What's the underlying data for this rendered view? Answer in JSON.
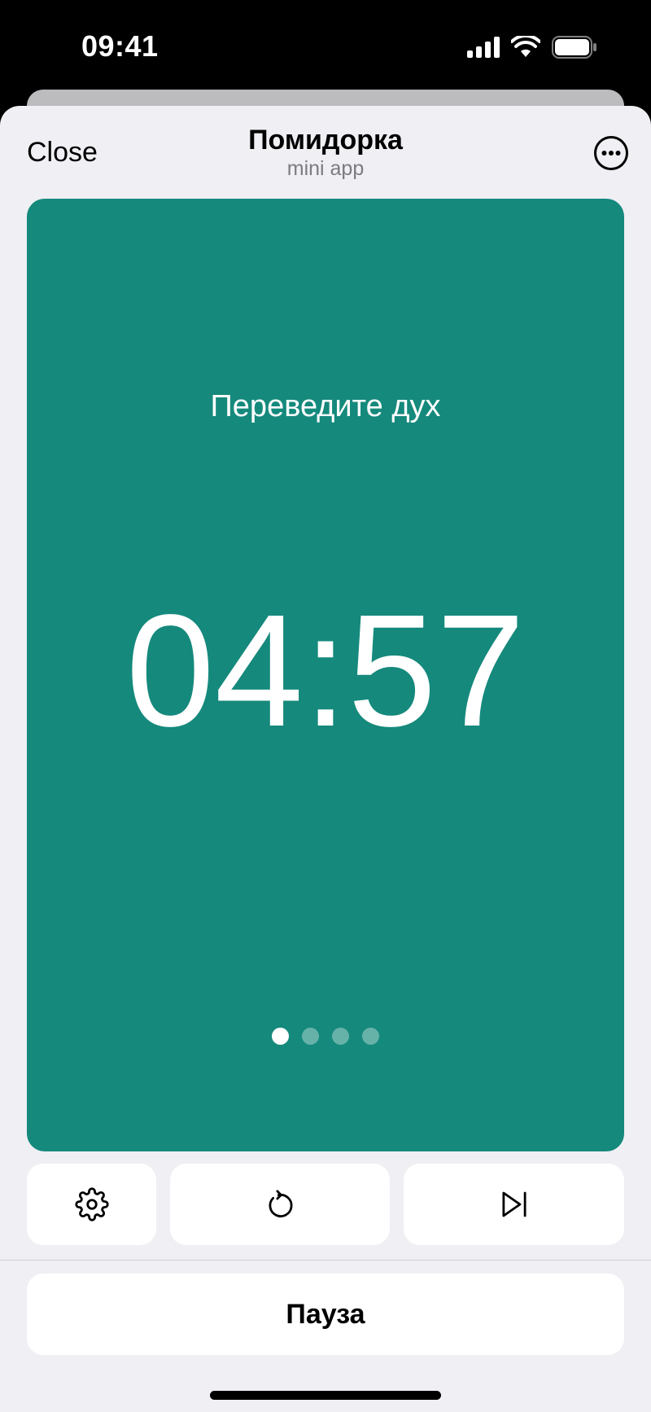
{
  "status_bar": {
    "time": "09:41",
    "icons": [
      "cellular-signal-icon",
      "wifi-icon",
      "battery-icon"
    ]
  },
  "header": {
    "close_label": "Close",
    "title": "Помидорка",
    "subtitle": "mini app",
    "more_icon": "more-circle-icon"
  },
  "timer": {
    "phase_label": "Переведите дух",
    "time_remaining": "04:57",
    "background_color": "#15897c",
    "session_dots_total": 4,
    "session_dots_active_index": 0
  },
  "controls": {
    "settings_icon": "gear-icon",
    "reset_icon": "restart-icon",
    "skip_icon": "skip-forward-icon"
  },
  "pause_button": {
    "label": "Пауза"
  }
}
